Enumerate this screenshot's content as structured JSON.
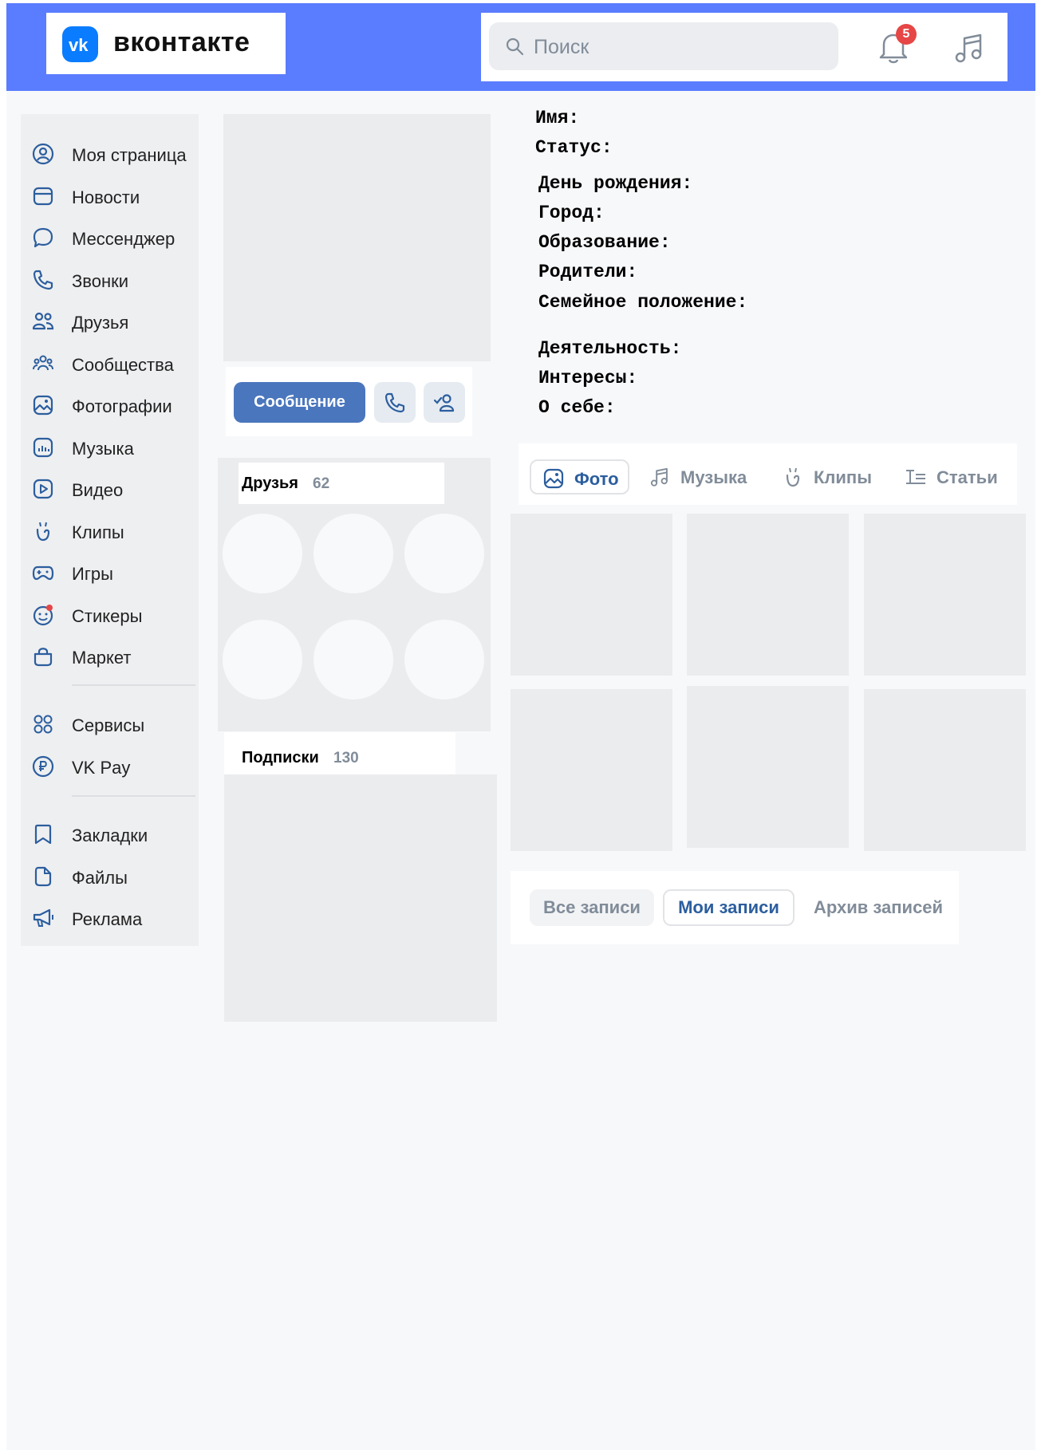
{
  "header": {
    "logo_text": "вконтакте",
    "search_placeholder": "Поиск",
    "notifications_count": "5"
  },
  "sidebar": {
    "items": [
      {
        "label": "Моя страница",
        "icon": "user-circle-icon"
      },
      {
        "label": "Новости",
        "icon": "news-icon"
      },
      {
        "label": "Мессенджер",
        "icon": "message-icon"
      },
      {
        "label": "Звонки",
        "icon": "phone-icon"
      },
      {
        "label": "Друзья",
        "icon": "friends-icon"
      },
      {
        "label": "Сообщества",
        "icon": "communities-icon"
      },
      {
        "label": "Фотографии",
        "icon": "photo-icon"
      },
      {
        "label": "Музыка",
        "icon": "music-icon"
      },
      {
        "label": "Видео",
        "icon": "video-icon"
      },
      {
        "label": "Клипы",
        "icon": "clips-icon"
      },
      {
        "label": "Игры",
        "icon": "gamepad-icon"
      },
      {
        "label": "Стикеры",
        "icon": "sticker-icon"
      },
      {
        "label": "Маркет",
        "icon": "market-icon"
      },
      {
        "label": "Сервисы",
        "icon": "services-icon"
      },
      {
        "label": "VK Pay",
        "icon": "vkpay-icon"
      },
      {
        "label": "Закладки",
        "icon": "bookmark-icon"
      },
      {
        "label": "Файлы",
        "icon": "file-icon"
      },
      {
        "label": "Реклама",
        "icon": "megaphone-icon"
      }
    ]
  },
  "profile": {
    "message_button": "Сообщение",
    "fields": [
      "Имя:",
      "Статус:",
      "День рождения:",
      "Город:",
      "Образование:",
      "Родители:",
      "Семейное положение:",
      "Деятельность:",
      "Интересы:",
      "О себе:"
    ]
  },
  "friends": {
    "title": "Друзья",
    "count": "62"
  },
  "subscriptions": {
    "title": "Подписки",
    "count": "130"
  },
  "media_tabs": [
    "Фото",
    "Музыка",
    "Клипы",
    "Статьи"
  ],
  "posts_tabs": [
    "Все записи",
    "Мои записи",
    "Архив записей"
  ],
  "colors": {
    "header": "#5a7cff",
    "accent": "#4a76bd",
    "badge": "#e64646"
  }
}
